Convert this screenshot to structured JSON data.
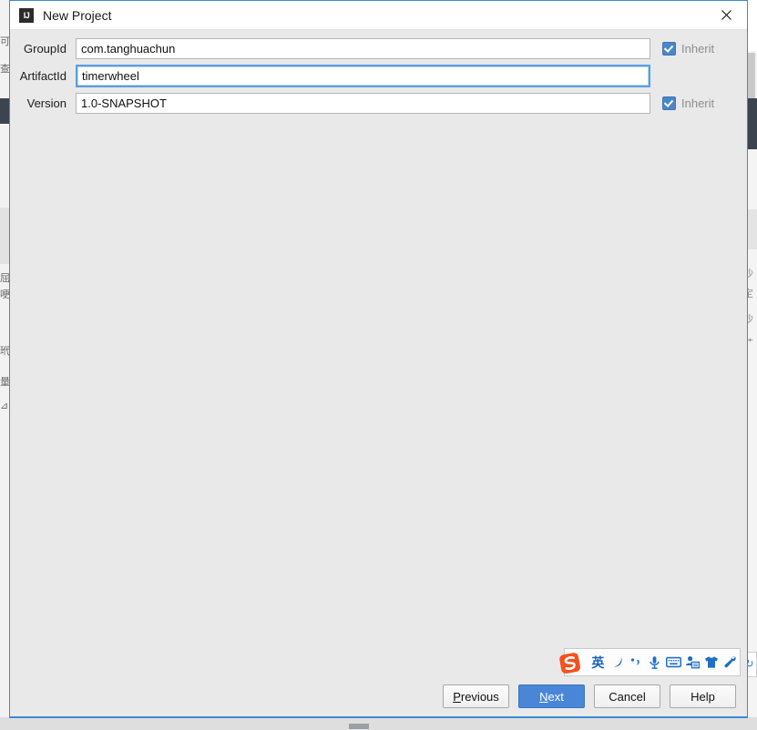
{
  "window": {
    "title": "New Project",
    "app_icon": "intellij-idea-icon",
    "close_icon": "close-icon",
    "accent_color": "#3b8bd4",
    "body_color": "#e9e9e9"
  },
  "form": {
    "fields": [
      {
        "label": "GroupId",
        "value": "com.tanghuachun",
        "focused": false,
        "inherit": {
          "label": "Inherit",
          "checked": true,
          "visible": true
        }
      },
      {
        "label": "ArtifactId",
        "value": "timerwheel",
        "focused": true,
        "inherit": {
          "label": "",
          "checked": false,
          "visible": false
        }
      },
      {
        "label": "Version",
        "value": "1.0-SNAPSHOT",
        "focused": false,
        "inherit": {
          "label": "Inherit",
          "checked": true,
          "visible": true
        }
      }
    ]
  },
  "footer": {
    "buttons": [
      {
        "label": "Previous",
        "mnemonic": "P",
        "primary": false
      },
      {
        "label": "Next",
        "mnemonic": "N",
        "primary": true
      },
      {
        "label": "Cancel",
        "mnemonic": "",
        "primary": false
      },
      {
        "label": "Help",
        "mnemonic": "",
        "primary": false
      }
    ]
  },
  "ime_toolbar": {
    "name": "sogou-input-method-toolbar",
    "logo": "sogou-logo-icon",
    "items": [
      {
        "name": "language-mode-chinese-english",
        "glyph": "英"
      },
      {
        "name": "moon-icon",
        "glyph": ""
      },
      {
        "name": "punctuation-mode-icon",
        "glyph": ""
      },
      {
        "name": "microphone-icon",
        "glyph": ""
      },
      {
        "name": "soft-keyboard-icon",
        "glyph": ""
      },
      {
        "name": "user-center-icon",
        "glyph": ""
      },
      {
        "name": "skin-tshirt-icon",
        "glyph": ""
      },
      {
        "name": "tools-wrench-icon",
        "glyph": ""
      }
    ]
  },
  "backdrop": {
    "left_glyphs": [
      "可",
      "查",
      "屈",
      "哽",
      "玳",
      "量",
      "⊿"
    ],
    "right_glyphs": [
      "沙",
      "定",
      "沙",
      "艹"
    ],
    "dark_color": "#3c4450"
  }
}
